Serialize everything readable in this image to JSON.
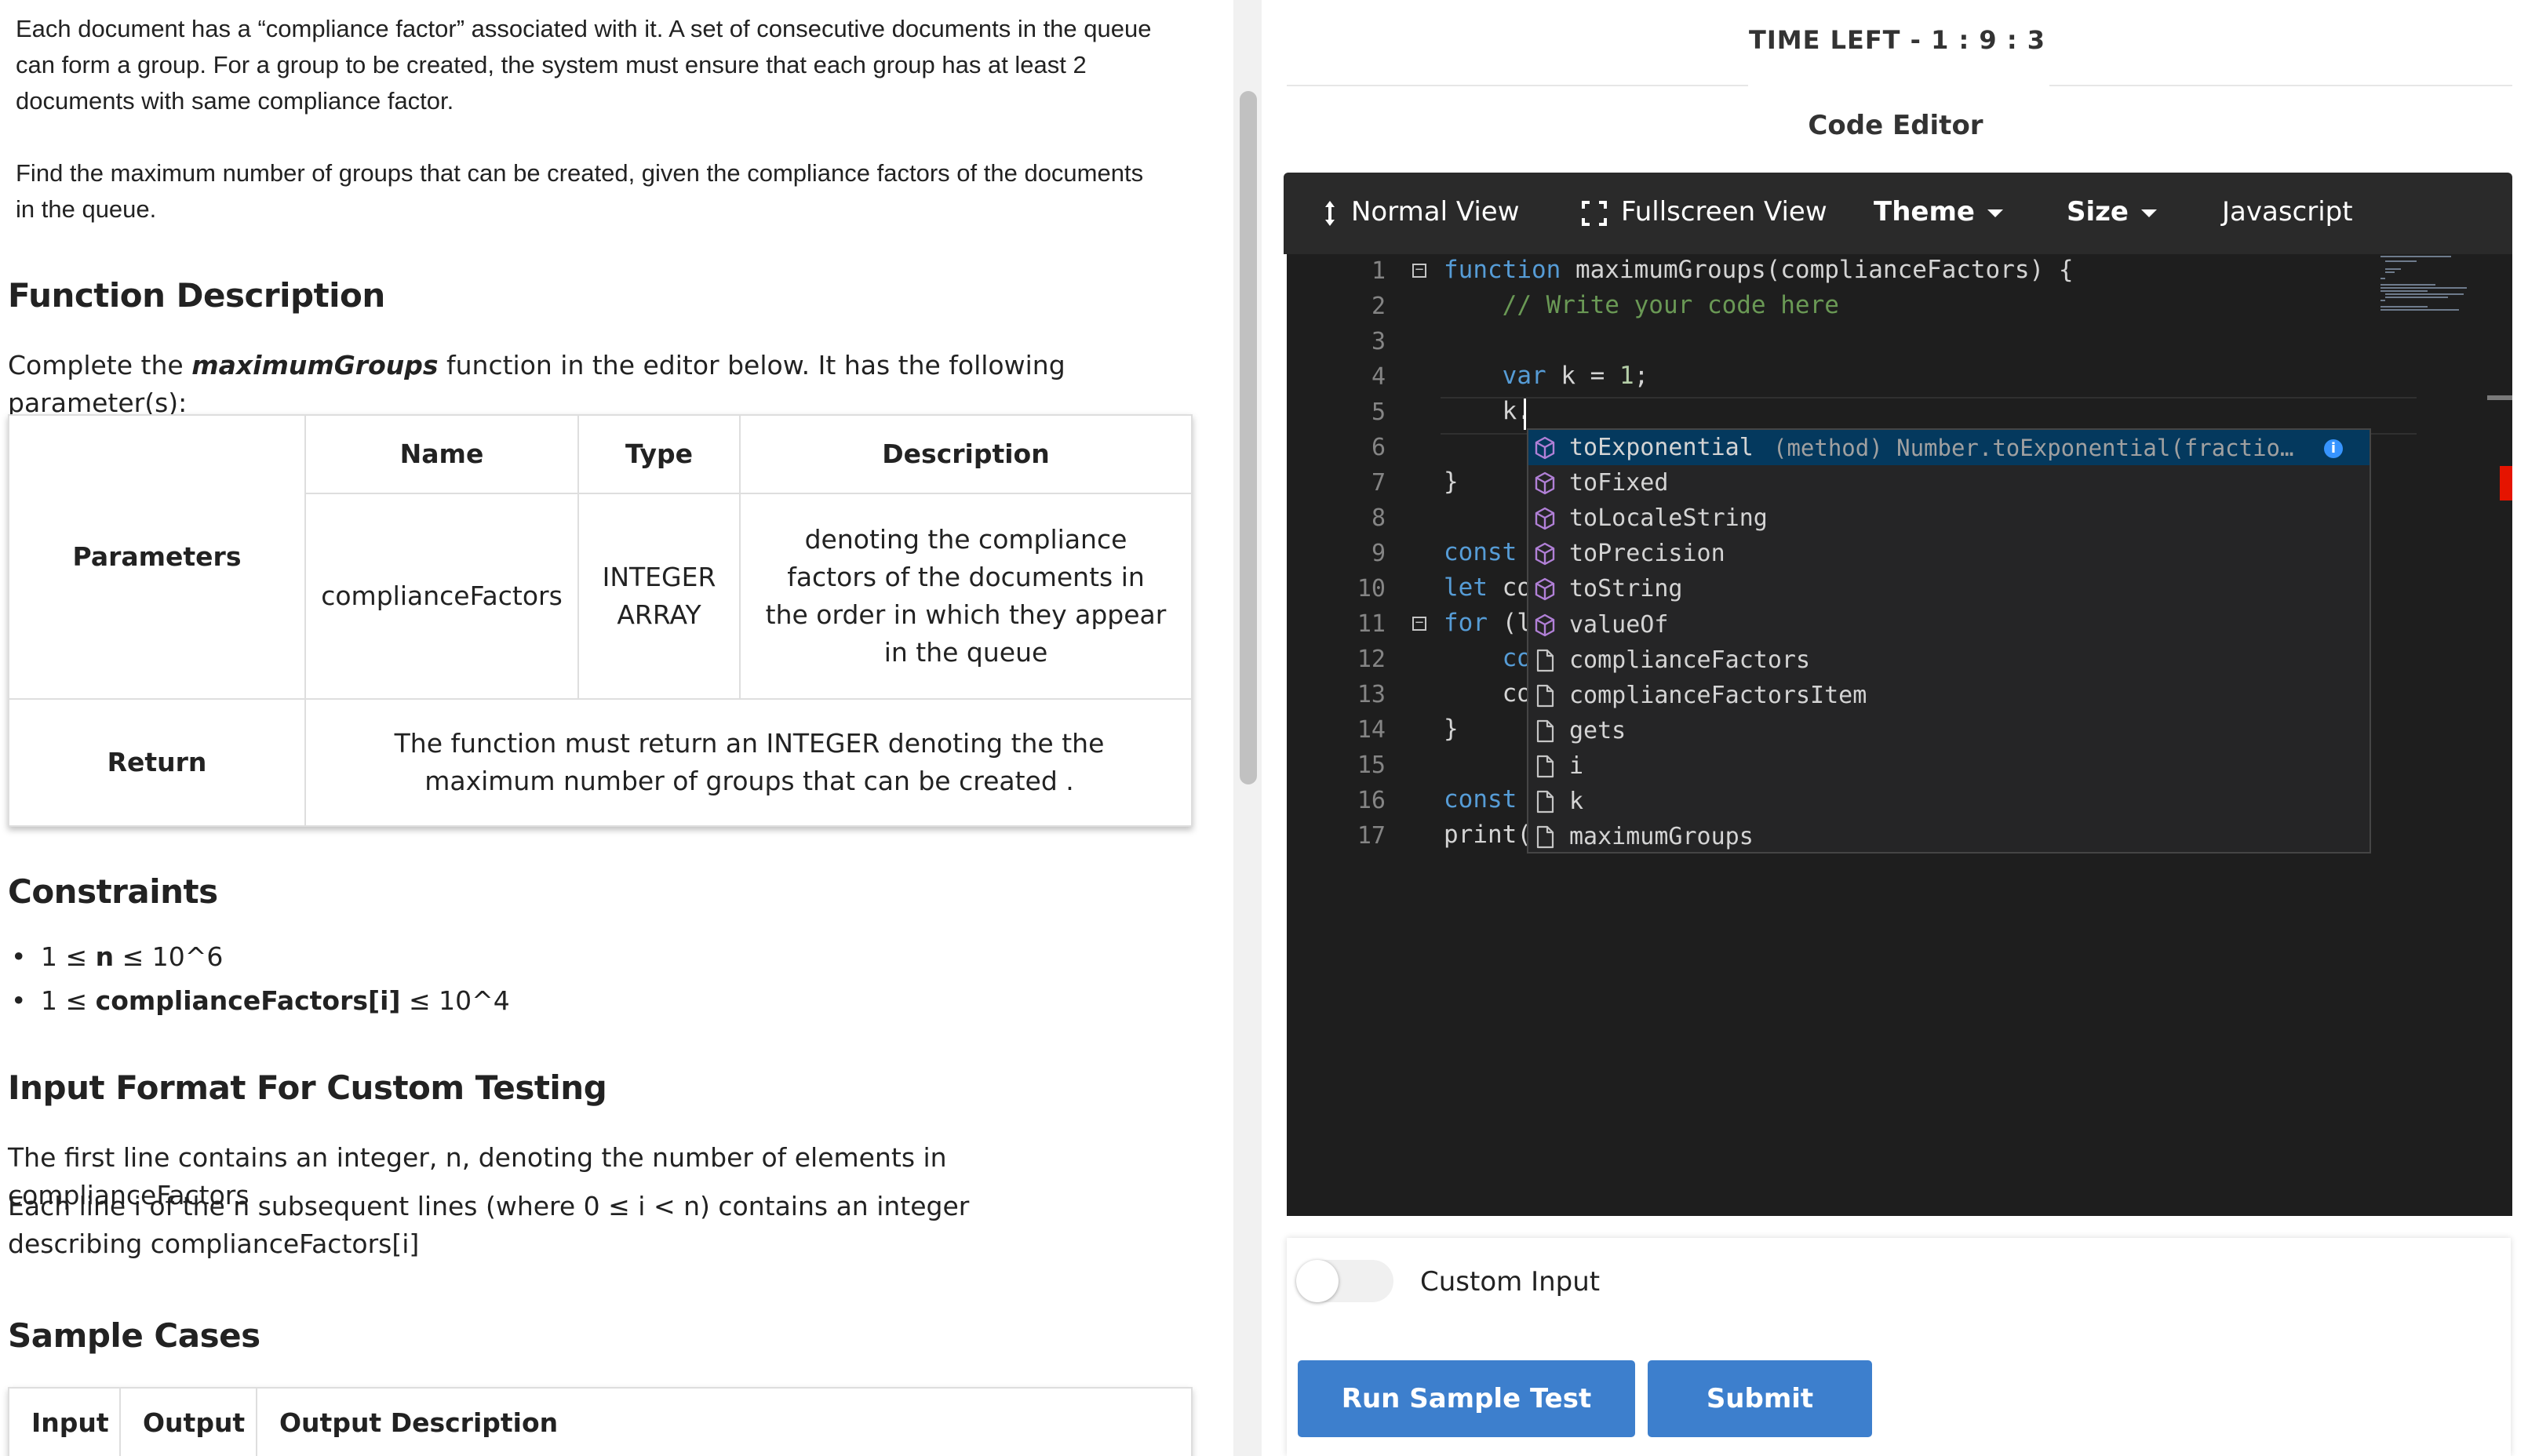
{
  "problem": {
    "intro_1": "Each document has a “compliance factor” associated with it. A set of consecutive documents in the queue can form a group. For a group to be created, the system must ensure that each group has at least 2 documents with same compliance factor.",
    "intro_2": "Find the maximum number of groups that can be created, given the compliance factors of the documents in the queue.",
    "function_description_heading": "Function Description",
    "complete_prefix": "Complete the ",
    "function_name": "maximumGroups",
    "complete_suffix": " function in the editor below. It has the following parameter(s):",
    "params_table": {
      "headers": [
        "Name",
        "Type",
        "Description"
      ],
      "parameters_label": "Parameters",
      "param_name": "complianceFactors",
      "param_type": "INTEGER ARRAY",
      "param_description": "denoting the compliance factors of the documents in the order in which they appear in the queue",
      "return_label": "Return",
      "return_description": "The function must return an INTEGER denoting the the maximum number of groups that can be created ."
    },
    "constraints_heading": "Constraints",
    "constraints": [
      {
        "prefix": "1 ≤ ",
        "bold": "n",
        "suffix": " ≤ 10^6"
      },
      {
        "prefix": "1 ≤ ",
        "bold": "complianceFactors[i]",
        "suffix": " ≤ 10^4"
      }
    ],
    "input_format_heading": "Input Format For Custom Testing",
    "input_format_1": "The first line contains an integer, n, denoting the number of elements in complianceFactors",
    "input_format_2": "Each line i of the n subsequent lines (where 0 ≤ i < n) contains an integer describing complianceFactors[i]",
    "sample_cases_heading": "Sample Cases",
    "sample_table_headers": [
      "Input",
      "Output",
      "Output Description"
    ]
  },
  "header": {
    "timer": "TIME LEFT - 1 : 9 : 3",
    "editor_title": "Code Editor"
  },
  "toolbar": {
    "normal_view": "Normal View",
    "fullscreen_view": "Fullscreen View",
    "theme": "Theme",
    "size": "Size",
    "language": "Javascript"
  },
  "editor": {
    "line_numbers": [
      "1",
      "2",
      "3",
      "4",
      "5",
      "6",
      "7",
      "8",
      "9",
      "10",
      "11",
      "12",
      "13",
      "14",
      "15",
      "16",
      "17"
    ],
    "lines": {
      "l1_kw": "function",
      "l1_rest": " maximumGroups(complianceFactors) {",
      "l2": "    // Write your code here",
      "l4_kw": "    var",
      "l4_mid": " k = ",
      "l4_num": "1",
      "l4_end": ";",
      "l5": "    k.",
      "l7": "}",
      "l9": "const",
      "l10_kw": "let",
      "l10_rest": " co",
      "l11_kw": "for",
      "l11_rest": " (l",
      "l12": "    co",
      "l13": "    co",
      "l14": "}",
      "l16": "const",
      "l17": "print("
    }
  },
  "suggestions": [
    {
      "label": "toExponential",
      "kind": "method",
      "detail": "(method) Number.toExponential(fractio…",
      "selected": true
    },
    {
      "label": "toFixed",
      "kind": "method"
    },
    {
      "label": "toLocaleString",
      "kind": "method"
    },
    {
      "label": "toPrecision",
      "kind": "method"
    },
    {
      "label": "toString",
      "kind": "method"
    },
    {
      "label": "valueOf",
      "kind": "method"
    },
    {
      "label": "complianceFactors",
      "kind": "text"
    },
    {
      "label": "complianceFactorsItem",
      "kind": "text"
    },
    {
      "label": "gets",
      "kind": "text"
    },
    {
      "label": "i",
      "kind": "text"
    },
    {
      "label": "k",
      "kind": "text"
    },
    {
      "label": "maximumGroups",
      "kind": "text"
    }
  ],
  "bottom": {
    "custom_input_label": "Custom Input",
    "custom_input_on": false,
    "run_sample_test": "Run Sample Test",
    "submit": "Submit"
  },
  "colors": {
    "button_blue": "#3d7fcd",
    "editor_bg": "#1e1e1e",
    "toolbar_bg": "#2a2a2a",
    "keyword": "#569cd6",
    "comment": "#6a9955",
    "method_icon": "#b180d7"
  }
}
